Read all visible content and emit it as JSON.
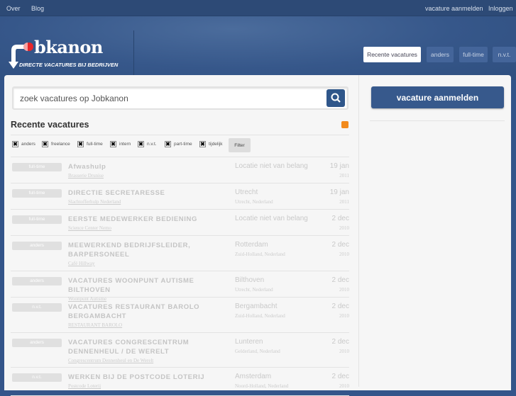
{
  "topbar": {
    "left": [
      "Over",
      "Blog"
    ],
    "right": [
      "vacature aanmelden",
      "Inloggen"
    ]
  },
  "logo": {
    "word": "bkanon",
    "tagline": "DIRECTE VACATURES BIJ BEDRIJVEN",
    "full": "Jobkanon"
  },
  "nav": [
    "Recente vacatures",
    "anders",
    "full-time",
    "n.v.t."
  ],
  "search": {
    "placeholder": "zoek vacatures op Jobkanon"
  },
  "list": {
    "heading": "Recente vacatures",
    "filters": [
      "anders",
      "freelance",
      "full-time",
      "intern",
      "n.v.t.",
      "part-time",
      "tijdelijk"
    ],
    "filter_button": "Filter",
    "jobs": [
      {
        "tag": "full-time",
        "title": "Afwashulp",
        "company": "Brasserie Drunise",
        "location": "Locatie niet van belang",
        "region": "",
        "day": "19 jan",
        "year": "2011"
      },
      {
        "tag": "full-time",
        "title": "DIRECTIE SECRETARESSE",
        "company": "Slachtofferhulp Nederland",
        "location": "Utrecht",
        "region": "Utrecht, Nederland",
        "day": "19 jan",
        "year": "2011"
      },
      {
        "tag": "full-time",
        "title": "EERSTE MEDEWERKER BEDIENING",
        "company": "Science Center Nemo",
        "location": "Locatie niet van belang",
        "region": "",
        "day": "2 dec",
        "year": "2010"
      },
      {
        "tag": "anders",
        "title": "MEEWERKEND BEDRIJFSLEIDER, BARPERSONEEL",
        "company": "Café Hillway",
        "location": "Rotterdam",
        "region": "Zuid-Holland, Nederland",
        "day": "2 dec",
        "year": "2010"
      },
      {
        "tag": "anders",
        "title": "VACATURES WOONPUNT AUTISME BILTHOVEN",
        "company": "Woonpunt Autisme",
        "location": "Bilthoven",
        "region": "Utrecht, Nederland",
        "day": "2 dec",
        "year": "2010"
      },
      {
        "tag": "n.v.t.",
        "title": "VACATURES RESTAURANT BAROLO BERGAMBACHT",
        "company": "RESTAURANT BAROLO",
        "location": "Bergambacht",
        "region": "Zuid-Holland, Nederland",
        "day": "2 dec",
        "year": "2010"
      },
      {
        "tag": "anders",
        "title": "VACATURES CONGRESCENTRUM DENNENHEUL / DE WERELT",
        "company": "Congrescentrum Dennenheul en De Werelt",
        "location": "Lunteren",
        "region": "Gelderland, Nederland",
        "day": "2 dec",
        "year": "2010"
      },
      {
        "tag": "n.v.t.",
        "title": "WERKEN BIJ DE POSTCODE LOTERIJ",
        "company": "Postcode Loterij",
        "location": "Amsterdam",
        "region": "Noord-Holland, Nederland",
        "day": "2 dec",
        "year": "2010"
      }
    ]
  },
  "sidebar": {
    "submit": "vacature aanmelden"
  }
}
